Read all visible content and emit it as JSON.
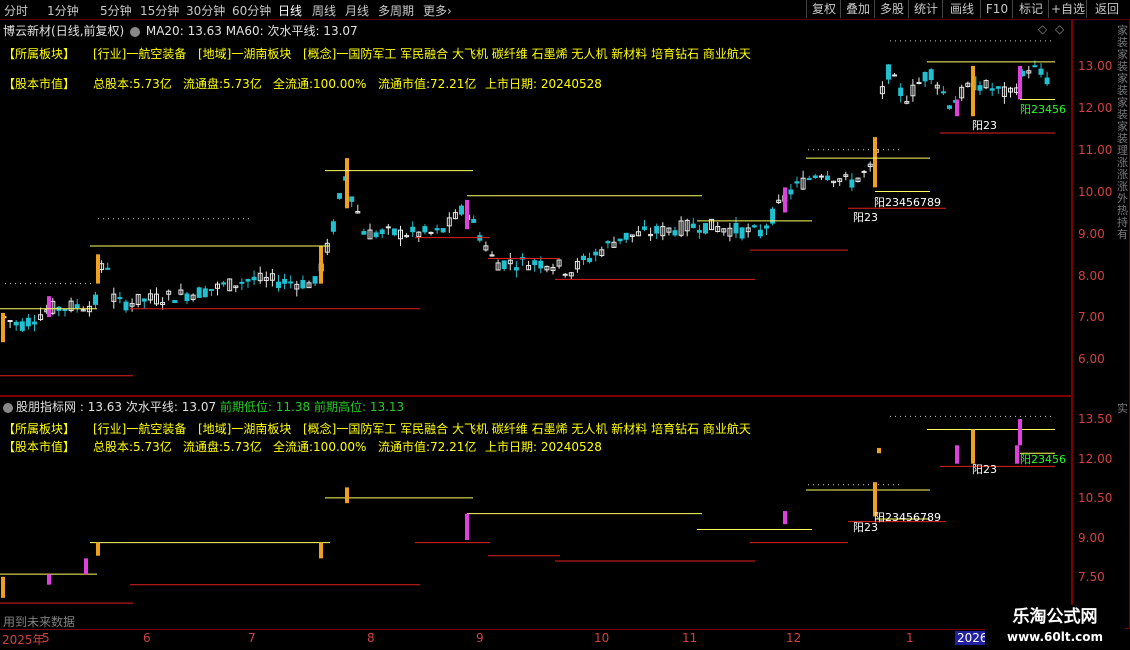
{
  "toolbar": {
    "periods": [
      "分时",
      "1分钟",
      "5分钟",
      "15分钟",
      "30分钟",
      "60分钟",
      "日线",
      "周线",
      "月线",
      "多周期",
      "更多"
    ],
    "active_period": "日线",
    "more_arrow": "›",
    "right_buttons": [
      "复权",
      "叠加",
      "多股",
      "统计",
      "画线",
      "F10",
      "标记",
      "+自选",
      "返回"
    ]
  },
  "main_panel": {
    "stock_name": "博云新材",
    "period_mode": "(日线,前复权)",
    "ma20_label": "MA20:",
    "ma20_value": "13.63",
    "ma60_label": "MA60:",
    "ma60_text": "次水平线: 13.07",
    "info": {
      "sector_label": "【所属板块】",
      "industry": "[行业]一航空装备",
      "region": "[地域]一湖南板块",
      "concept": "[概念]一国防军工 军民融合 大飞机 碳纤维 石墨烯 无人机 新材料 培育钻石 商业航天",
      "cap_label": "【股本市值】",
      "total_shares": "总股本:5.73亿",
      "float_shares": "流通盘:5.73亿",
      "full_float": "全流通:100.00%",
      "float_cap": "流通市值:72.21亿",
      "listing_date": "上市日期: 20240528"
    },
    "price_axis": [
      "13.00",
      "12.00",
      "11.00",
      "10.00",
      "9.00",
      "8.00",
      "7.00",
      "6.00"
    ],
    "annotations": [
      "阳23",
      "阳23456789",
      "阳23",
      "阳23456"
    ],
    "side_text": "家装家装家装家装家装理涨涨涨外热持有",
    "side_marker": "◇"
  },
  "indicator_panel": {
    "name": "股朋指标网",
    "value": ": 13.63",
    "line_label": "次水平线: 13.07",
    "low_label": "前期低位: 11.38",
    "high_label": "前期高位: 13.13",
    "info": {
      "sector_label": "【所属板块】",
      "industry": "[行业]一航空装备",
      "region": "[地域]一湖南板块",
      "concept": "[概念]一国防军工 军民融合 大飞机 碳纤维 石墨烯 无人机 新材料 培育钻石 商业航天",
      "cap_label": "【股本市值】",
      "total_shares": "总股本:5.73亿",
      "float_shares": "流通盘:5.73亿",
      "full_float": "全流通:100.00%",
      "float_cap": "流通市值:72.21亿",
      "listing_date": "上市日期: 20240528"
    },
    "axis": [
      "13.50",
      "12.00",
      "10.50",
      "9.00",
      "7.50"
    ],
    "annotations": [
      "阳23",
      "阳23456789",
      "阳23",
      "阳23456"
    ],
    "footer_note": "用到未来数据",
    "side_text": "实"
  },
  "date_axis": {
    "labels": [
      "2025年",
      "5",
      "6",
      "7",
      "8",
      "9",
      "10",
      "11",
      "12",
      "1"
    ],
    "highlight": "2026"
  },
  "watermark": {
    "line1": "乐淘公式网",
    "line2": "www.60lt.com"
  },
  "colors": {
    "up_candle": "#e8e8e8",
    "down_candle": "#20c0d0",
    "signal_candle": "#e040e0",
    "orange_candle": "#f0a020",
    "resistance_line": "#ffff60",
    "support_line": "#e02020",
    "axis_red": "#d24040"
  },
  "chart_data": {
    "type": "candlestick",
    "series": [
      {
        "x": [
          "2025-04",
          "2025-05",
          "2025-06",
          "2025-07",
          "2025-08",
          "2025-09",
          "2025-10",
          "2025-11",
          "2025-12",
          "2026-01"
        ],
        "close": [
          7.0,
          7.8,
          7.3,
          7.8,
          9.0,
          8.3,
          9.2,
          9.2,
          10.2,
          12.5
        ]
      }
    ],
    "ylim": [
      5.5,
      13.6
    ],
    "last_close": 13.07
  }
}
